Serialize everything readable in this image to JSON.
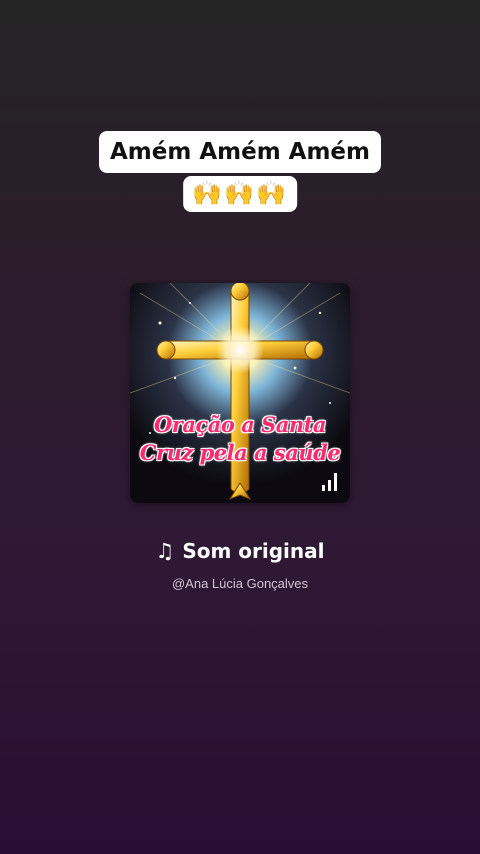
{
  "caption": {
    "line1": "Amém Amém Amém",
    "line2": "🙌🙌🙌"
  },
  "cover": {
    "title_line1": "Oração a Santa",
    "title_line2": "Cruz pela a saúde",
    "image": "golden-glowing-cross",
    "accent_color": "#ff2a6e",
    "icon": "audio-bars-icon"
  },
  "sound": {
    "icon": "music-note-icon",
    "title": "Som original",
    "author": "@Ana Lúcia Gonçalves"
  }
}
